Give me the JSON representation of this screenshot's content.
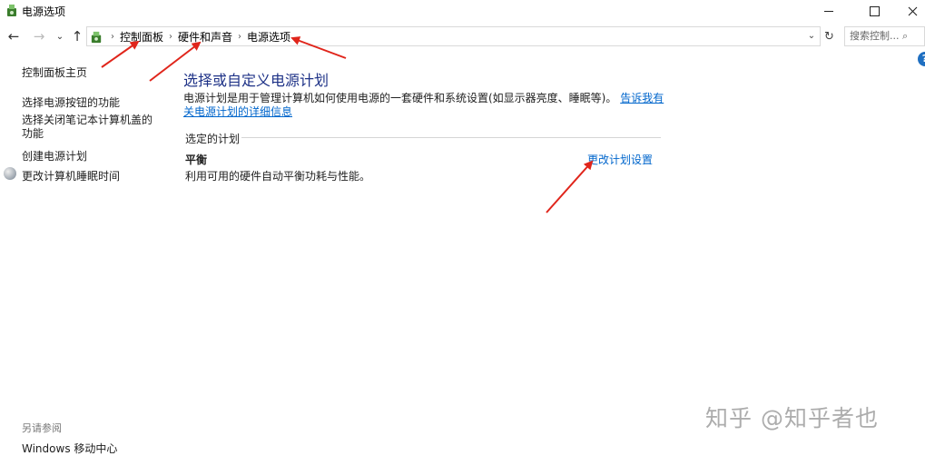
{
  "window": {
    "title": "电源选项",
    "icon": "power-options-icon",
    "controls": [
      "minimize",
      "maximize",
      "close"
    ]
  },
  "nav": {
    "back_icon": "←",
    "forward_icon": "→",
    "recent_icon": "⌄",
    "up_icon": "↑",
    "breadcrumb": [
      "控制面板",
      "硬件和声音",
      "电源选项"
    ],
    "dropdown_icon": "⌄",
    "refresh_icon": "↻",
    "search_placeholder": "搜索控制... ⌕"
  },
  "sidebar": {
    "home": "控制面板主页",
    "items": [
      "选择电源按钮的功能",
      "选择关闭笔记本计算机盖的功能",
      "创建电源计划",
      "更改计算机睡眠时间"
    ],
    "see_also_title": "另请参阅",
    "see_also_items": [
      "Windows 移动中心"
    ]
  },
  "main": {
    "title": "选择或自定义电源计划",
    "description": "电源计划是用于管理计算机如何使用电源的一套硬件和系统设置(如显示器亮度、睡眠等)。",
    "learn_more_link": "告诉我有关电源计划的详细信息",
    "selected_plan_heading": "选定的计划",
    "plan_name": "平衡",
    "plan_description": "利用可用的硬件自动平衡功耗与性能。",
    "change_plan_link": "更改计划设置"
  },
  "help_label": "?",
  "annotation_color": "#e0251b",
  "watermark": "知乎 @知乎者也"
}
